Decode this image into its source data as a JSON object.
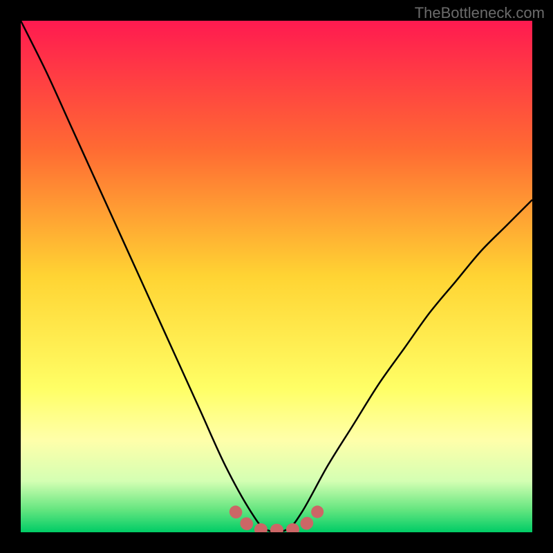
{
  "watermark": "TheBottleneck.com",
  "chart_data": {
    "type": "line",
    "title": "",
    "xlabel": "",
    "ylabel": "",
    "xlim": [
      0,
      100
    ],
    "ylim": [
      0,
      100
    ],
    "series": [
      {
        "name": "bottleneck-curve",
        "x": [
          0,
          5,
          10,
          15,
          20,
          25,
          30,
          35,
          40,
          45,
          48,
          52,
          55,
          60,
          65,
          70,
          75,
          80,
          85,
          90,
          95,
          100
        ],
        "values": [
          100,
          90,
          79,
          68,
          57,
          46,
          35,
          24,
          13,
          4,
          0.5,
          0.5,
          4,
          13,
          21,
          29,
          36,
          43,
          49,
          55,
          60,
          65
        ]
      }
    ],
    "highlight": {
      "name": "optimum-flat",
      "x": [
        42,
        45,
        48,
        52,
        55,
        58
      ],
      "values": [
        4,
        1,
        0.5,
        0.5,
        1,
        4
      ],
      "color": "#cc6666"
    },
    "background_gradient": {
      "stops": [
        {
          "offset": 0.0,
          "color": "#ff1a50"
        },
        {
          "offset": 0.25,
          "color": "#ff6a33"
        },
        {
          "offset": 0.5,
          "color": "#ffd433"
        },
        {
          "offset": 0.72,
          "color": "#ffff66"
        },
        {
          "offset": 0.82,
          "color": "#ffffaa"
        },
        {
          "offset": 0.9,
          "color": "#d4ffb3"
        },
        {
          "offset": 0.955,
          "color": "#66e680"
        },
        {
          "offset": 1.0,
          "color": "#00cc66"
        }
      ]
    }
  }
}
